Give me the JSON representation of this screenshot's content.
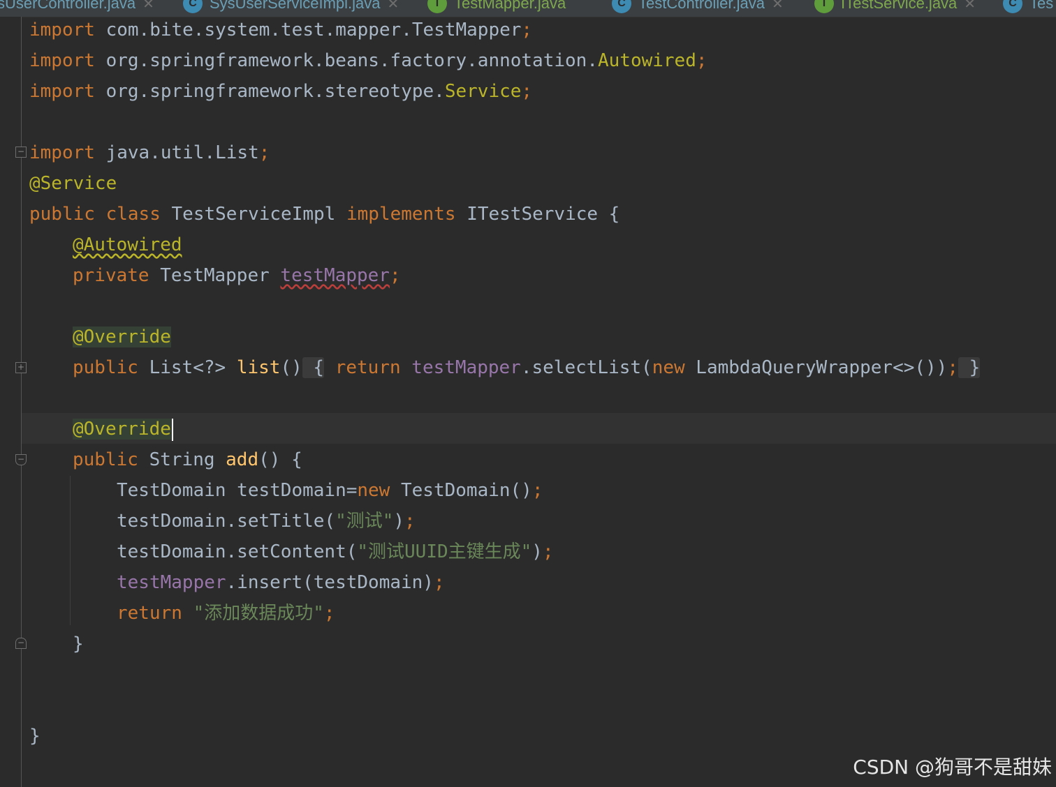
{
  "tabs": [
    {
      "label": "sUserController.java",
      "icon_letter": "",
      "kind": "class",
      "active": false
    },
    {
      "label": "SysUserServiceImpl.java",
      "icon_letter": "C",
      "kind": "class",
      "active": false
    },
    {
      "label": "TestMapper.java",
      "icon_letter": "I",
      "kind": "interface",
      "active": false
    },
    {
      "label": "TestController.java",
      "icon_letter": "C",
      "kind": "class",
      "active": false
    },
    {
      "label": "ITestService.java",
      "icon_letter": "I",
      "kind": "interface",
      "active": false
    },
    {
      "label": "Tes",
      "icon_letter": "C",
      "kind": "class",
      "active": true
    }
  ],
  "colors": {
    "background": "#2b2b2b",
    "keyword": "#cc7832",
    "annotation": "#bbb529",
    "field": "#9876aa",
    "string": "#6a8759",
    "method": "#ffc66d",
    "text": "#a9b7c6"
  },
  "code": {
    "l1": {
      "kw": "import",
      "path": " com.bite.system.test.mapper.TestMapper",
      "semi": ";"
    },
    "l2": {
      "kw": "import",
      "path": " org.springframework.beans.factory.annotation.",
      "ann": "Autowired",
      "semi": ";"
    },
    "l3": {
      "kw": "import",
      "path": " org.springframework.stereotype.",
      "ann": "Service",
      "semi": ";"
    },
    "l5": {
      "kw": "import",
      "path": " java.util.List",
      "semi": ";"
    },
    "l6": {
      "ann": "@Service"
    },
    "l7": {
      "kw1": "public",
      "kw2": "class",
      "name": "TestServiceImpl",
      "kw3": "implements",
      "iface": "ITestService {"
    },
    "l8": {
      "ann": "@Autowired"
    },
    "l9": {
      "kw": "private",
      "type": " TestMapper ",
      "field": "testMapper",
      "semi": ";"
    },
    "l11": {
      "ann": "@Override"
    },
    "l12": {
      "kw": "public",
      "type": " List<?> ",
      "fn": "list",
      "parens": "()",
      "open": " {",
      "ret": "return",
      "field": "testMapper",
      "call": ".selectList(",
      "new": "new",
      "rest": " LambdaQueryWrapper<>())",
      "semi": ";",
      "close": " }"
    },
    "l14": {
      "ann": "@Override"
    },
    "l15": {
      "kw": "public",
      "type": " String ",
      "fn": "add",
      "rest": "() {"
    },
    "l16": {
      "text": "TestDomain testDomain=",
      "new": "new",
      "rest": " TestDomain()",
      "semi": ";"
    },
    "l17": {
      "text": "testDomain.setTitle(",
      "str": "\"测试\"",
      "rest": ")",
      "semi": ";"
    },
    "l18": {
      "text": "testDomain.setContent(",
      "str": "\"测试UUID主键生成\"",
      "rest": ")",
      "semi": ";"
    },
    "l19": {
      "field": "testMapper",
      "rest": ".insert(testDomain)",
      "semi": ";"
    },
    "l20": {
      "kw": "return",
      "str": " \"添加数据成功\"",
      "semi": ";"
    },
    "l21": {
      "text": "}"
    },
    "l24": {
      "text": "}"
    }
  },
  "watermark": "CSDN @狗哥不是甜妹"
}
